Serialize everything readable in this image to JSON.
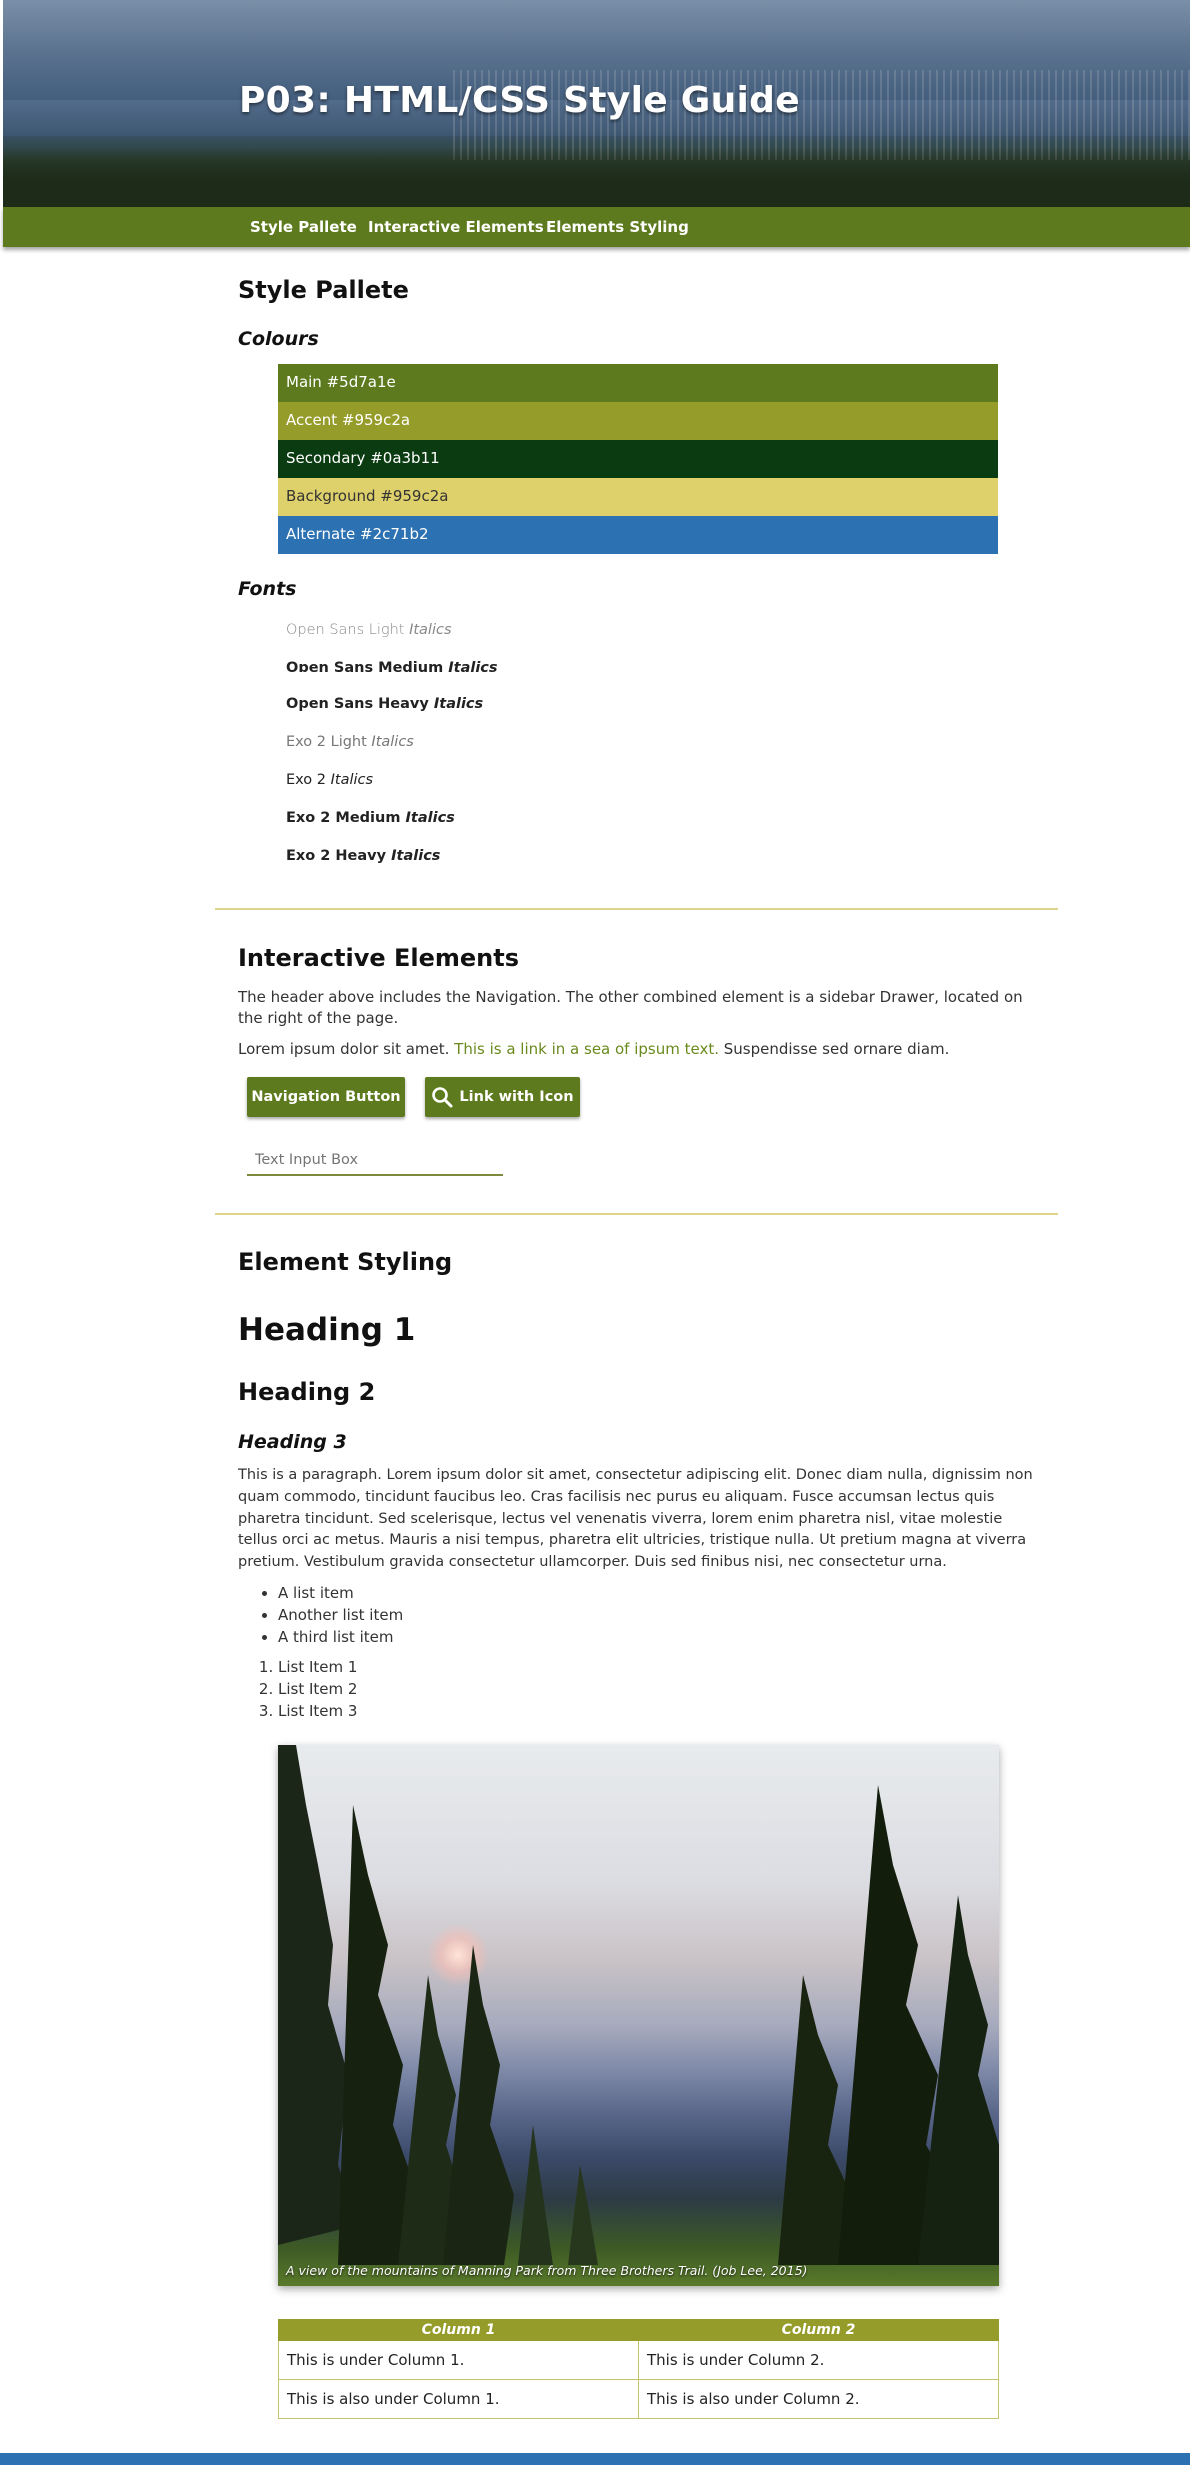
{
  "header": {
    "title": "P03: HTML/CSS Style Guide"
  },
  "nav": {
    "items": [
      "Style Pallete",
      "Interactive Elements",
      "Elements Styling"
    ]
  },
  "style_pallete": {
    "title": "Style Pallete",
    "colours_heading": "Colours",
    "colours": [
      {
        "label": "Main #5d7a1e",
        "color": "#5d7a1e",
        "text": "#ffffff"
      },
      {
        "label": "Accent #959c2a",
        "color": "#959c2a",
        "text": "#ffffff"
      },
      {
        "label": "Secondary #0a3b11",
        "color": "#0a3b11",
        "text": "#ffffff"
      },
      {
        "label": "Background #959c2a",
        "color": "#ded06a",
        "text": "#333333"
      },
      {
        "label": "Alternate #2c71b2",
        "color": "#2c71b2",
        "text": "#ffffff"
      }
    ],
    "fonts_heading": "Fonts",
    "fonts": [
      {
        "name": "Open Sans Light",
        "italic": "Italics"
      },
      {
        "name": "Open Sans Medium",
        "italic": "Italics"
      },
      {
        "name": "Open Sans Heavy",
        "italic": "Italics"
      },
      {
        "name": "Exo 2 Light",
        "italic": "Italics"
      },
      {
        "name": "Exo 2",
        "italic": "Italics"
      },
      {
        "name": "Exo 2 Medium",
        "italic": "Italics"
      },
      {
        "name": "Exo 2 Heavy",
        "italic": "Italics"
      }
    ]
  },
  "interactive": {
    "title": "Interactive Elements",
    "intro": "The header above includes the Navigation. The other combined element is a sidebar Drawer, located on the right of the page.",
    "lorem_before": "Lorem ipsum dolor sit amet. ",
    "lorem_link": "This is a link in a sea of ipsum text.",
    "lorem_after": " Suspendisse sed ornare diam.",
    "nav_button": "Navigation Button",
    "icon_button": "Link with Icon",
    "input_placeholder": "Text Input Box"
  },
  "styling": {
    "title": "Element Styling",
    "h1": "Heading 1",
    "h2": "Heading 2",
    "h3": "Heading 3",
    "paragraph": "This is a paragraph. Lorem ipsum dolor sit amet, consectetur adipiscing elit. Donec diam nulla, dignissim non quam commodo, tincidunt faucibus leo. Cras facilisis nec purus eu aliquam. Fusce accumsan lectus quis pharetra tincidunt. Sed scelerisque, lectus vel venenatis viverra, lorem enim pharetra nisl, vitae molestie tellus orci ac metus. Mauris a nisi tempus, pharetra elit ultricies, tristique nulla. Ut pretium magna at viverra pretium. Vestibulum gravida consectetur ullamcorper. Duis sed finibus nisi, nec consectetur urna.",
    "ul": [
      "A list item",
      "Another list item",
      "A third list item"
    ],
    "ol": [
      "List Item 1",
      "List Item 2",
      "List Item 3"
    ],
    "image_caption": "A view of the mountains of Manning Park from Three Brothers Trail. (Job Lee, 2015)",
    "table": {
      "headers": [
        "Column 1",
        "Column 2"
      ],
      "rows": [
        [
          "This is under Column 1.",
          "This is under Column 2."
        ],
        [
          "This is also under Column 1.",
          "This is also under Column 2."
        ]
      ]
    }
  }
}
